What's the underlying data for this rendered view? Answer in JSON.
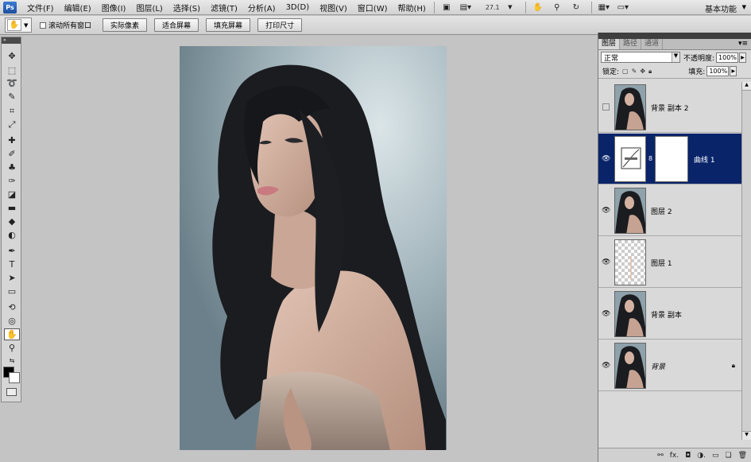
{
  "app": {
    "logo": "Ps",
    "menus": [
      "文件(F)",
      "编辑(E)",
      "图像(I)",
      "图层(L)",
      "选择(S)",
      "滤镜(T)",
      "分析(A)",
      "3D(D)",
      "视图(V)",
      "窗口(W)",
      "帮助(H)"
    ],
    "zoom": "27.1",
    "workspace": "基本功能"
  },
  "options": {
    "scroll_all_label": "滚动所有窗口",
    "buttons": [
      "实际像素",
      "适合屏幕",
      "填充屏幕",
      "打印尺寸"
    ]
  },
  "layers_panel": {
    "tabs": [
      "图层",
      "路径",
      "通道"
    ],
    "blend_mode": "正常",
    "opacity_label": "不透明度:",
    "opacity_value": "100%",
    "lock_label": "锁定:",
    "fill_label": "填充:",
    "fill_value": "100%",
    "layers": [
      {
        "name": "背景 副本 2",
        "visible": false,
        "selected": false,
        "italic": false,
        "locked": false
      },
      {
        "name": "曲线 1",
        "visible": true,
        "selected": true,
        "italic": false,
        "locked": false
      },
      {
        "name": "图层 2",
        "visible": true,
        "selected": false,
        "italic": false,
        "locked": false
      },
      {
        "name": "图层 1",
        "visible": true,
        "selected": false,
        "italic": false,
        "locked": false
      },
      {
        "name": "背景 副本",
        "visible": true,
        "selected": false,
        "italic": false,
        "locked": false
      },
      {
        "name": "背景",
        "visible": true,
        "selected": false,
        "italic": true,
        "locked": true
      }
    ]
  },
  "colors": {
    "selection": "#0a246a",
    "workspace_bg": "#c4c4c4",
    "foreground": "#000000",
    "background": "#ffffff"
  }
}
